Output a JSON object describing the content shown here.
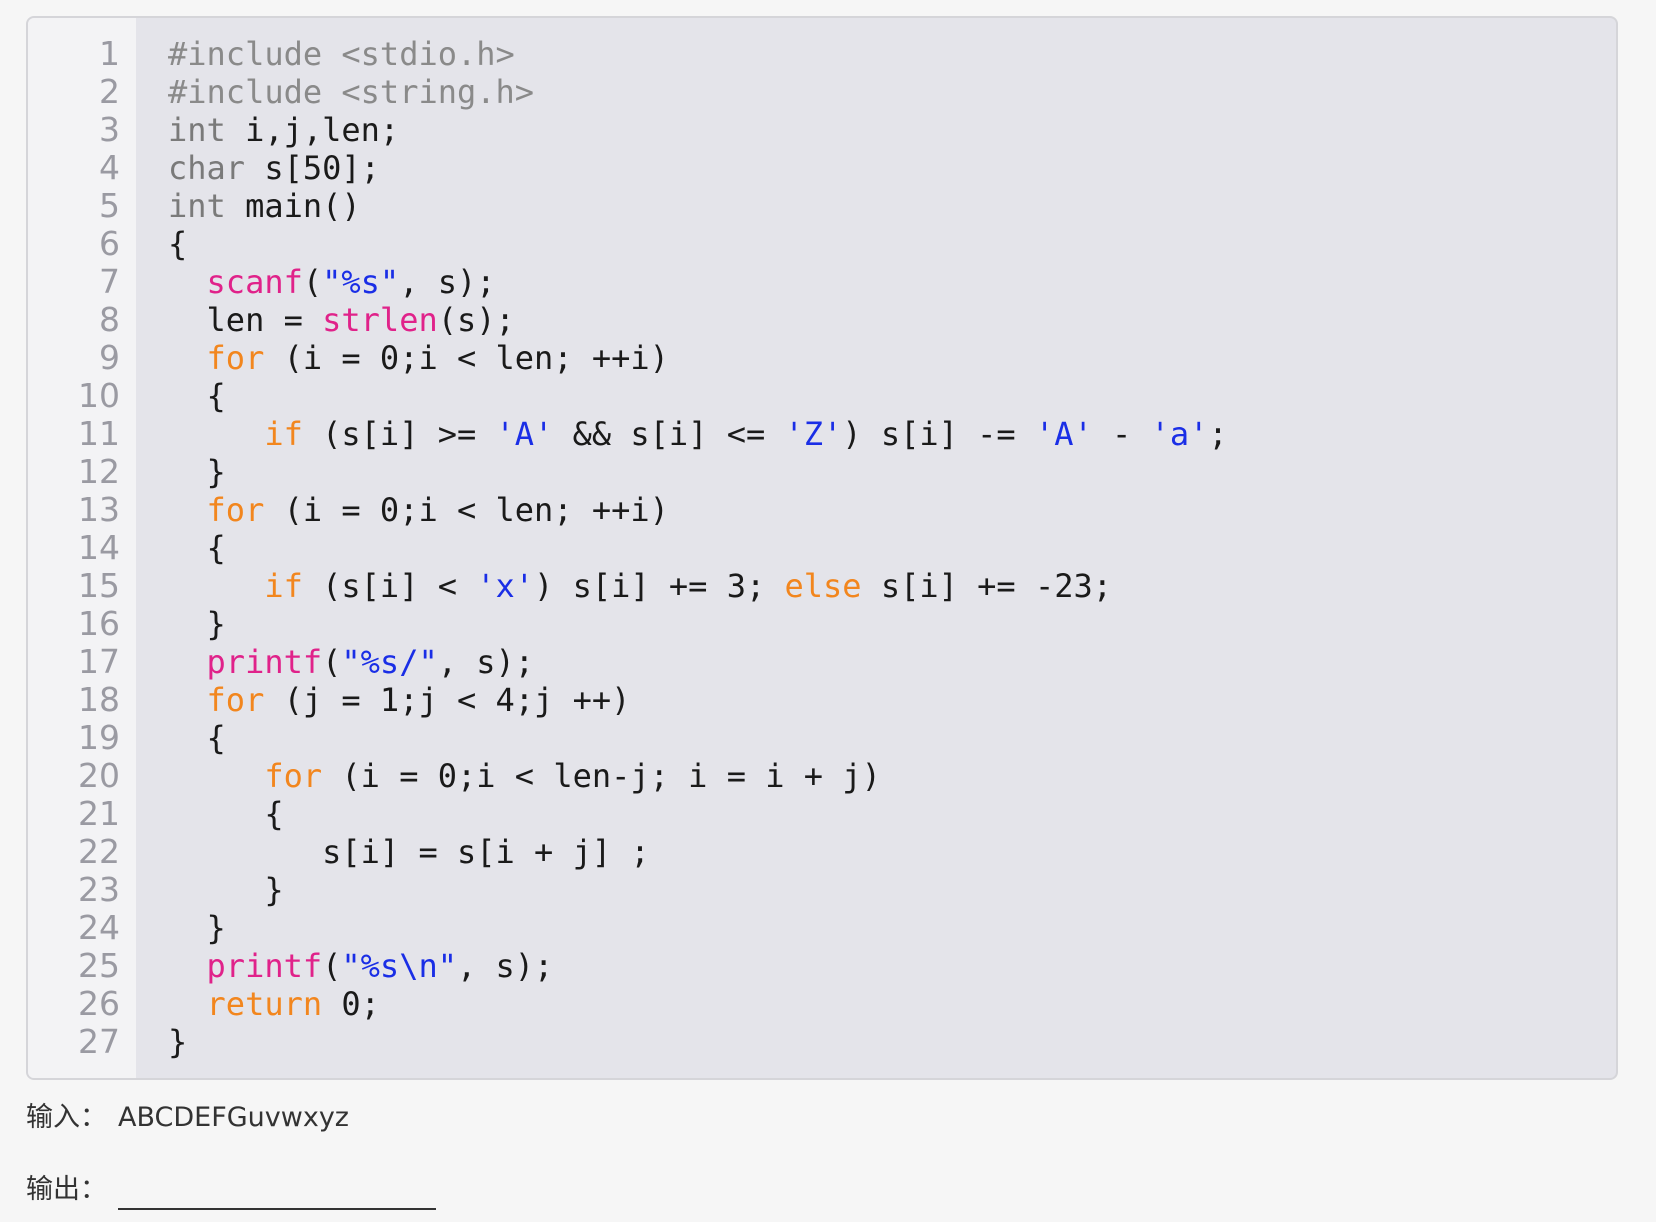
{
  "colors": {
    "preprocessor": "#8a8a8a",
    "type": "#7a7a7a",
    "keyword": "#f2861e",
    "function": "#e0228a",
    "string": "#1a2ee6",
    "plain": "#1a1a1a"
  },
  "code": {
    "lines": [
      {
        "num": "1",
        "tokens": [
          {
            "t": "pre",
            "v": "#include <stdio.h>"
          }
        ]
      },
      {
        "num": "2",
        "tokens": [
          {
            "t": "pre",
            "v": "#include <string.h>"
          }
        ]
      },
      {
        "num": "3",
        "tokens": [
          {
            "t": "type",
            "v": "int"
          },
          {
            "t": "plain",
            "v": " i,j,len;"
          }
        ]
      },
      {
        "num": "4",
        "tokens": [
          {
            "t": "type",
            "v": "char"
          },
          {
            "t": "plain",
            "v": " s[50];"
          }
        ]
      },
      {
        "num": "5",
        "tokens": [
          {
            "t": "type",
            "v": "int"
          },
          {
            "t": "plain",
            "v": " main()"
          }
        ]
      },
      {
        "num": "6",
        "tokens": [
          {
            "t": "plain",
            "v": "{"
          }
        ]
      },
      {
        "num": "7",
        "tokens": [
          {
            "t": "plain",
            "v": "  "
          },
          {
            "t": "fn",
            "v": "scanf"
          },
          {
            "t": "plain",
            "v": "("
          },
          {
            "t": "str",
            "v": "\"%s\""
          },
          {
            "t": "plain",
            "v": ", s);"
          }
        ]
      },
      {
        "num": "8",
        "tokens": [
          {
            "t": "plain",
            "v": "  len = "
          },
          {
            "t": "fn",
            "v": "strlen"
          },
          {
            "t": "plain",
            "v": "(s);"
          }
        ]
      },
      {
        "num": "9",
        "tokens": [
          {
            "t": "plain",
            "v": "  "
          },
          {
            "t": "kw",
            "v": "for"
          },
          {
            "t": "plain",
            "v": " (i = 0;i < len; ++i)"
          }
        ]
      },
      {
        "num": "10",
        "tokens": [
          {
            "t": "plain",
            "v": "  {"
          }
        ]
      },
      {
        "num": "11",
        "tokens": [
          {
            "t": "plain",
            "v": "     "
          },
          {
            "t": "kw",
            "v": "if"
          },
          {
            "t": "plain",
            "v": " (s[i] >= "
          },
          {
            "t": "str",
            "v": "'A'"
          },
          {
            "t": "plain",
            "v": " && s[i] <= "
          },
          {
            "t": "str",
            "v": "'Z'"
          },
          {
            "t": "plain",
            "v": ") s[i] -= "
          },
          {
            "t": "str",
            "v": "'A'"
          },
          {
            "t": "plain",
            "v": " - "
          },
          {
            "t": "str",
            "v": "'a'"
          },
          {
            "t": "plain",
            "v": ";"
          }
        ]
      },
      {
        "num": "12",
        "tokens": [
          {
            "t": "plain",
            "v": "  }"
          }
        ]
      },
      {
        "num": "13",
        "tokens": [
          {
            "t": "plain",
            "v": "  "
          },
          {
            "t": "kw",
            "v": "for"
          },
          {
            "t": "plain",
            "v": " (i = 0;i < len; ++i)"
          }
        ]
      },
      {
        "num": "14",
        "tokens": [
          {
            "t": "plain",
            "v": "  {"
          }
        ]
      },
      {
        "num": "15",
        "tokens": [
          {
            "t": "plain",
            "v": "     "
          },
          {
            "t": "kw",
            "v": "if"
          },
          {
            "t": "plain",
            "v": " (s[i] < "
          },
          {
            "t": "str",
            "v": "'x'"
          },
          {
            "t": "plain",
            "v": ") s[i] += 3; "
          },
          {
            "t": "kw",
            "v": "else"
          },
          {
            "t": "plain",
            "v": " s[i] += -23;"
          }
        ]
      },
      {
        "num": "16",
        "tokens": [
          {
            "t": "plain",
            "v": "  }"
          }
        ]
      },
      {
        "num": "17",
        "tokens": [
          {
            "t": "plain",
            "v": "  "
          },
          {
            "t": "fn",
            "v": "printf"
          },
          {
            "t": "plain",
            "v": "("
          },
          {
            "t": "str",
            "v": "\"%s/\""
          },
          {
            "t": "plain",
            "v": ", s);"
          }
        ]
      },
      {
        "num": "18",
        "tokens": [
          {
            "t": "plain",
            "v": "  "
          },
          {
            "t": "kw",
            "v": "for"
          },
          {
            "t": "plain",
            "v": " (j = 1;j < 4;j ++)"
          }
        ]
      },
      {
        "num": "19",
        "tokens": [
          {
            "t": "plain",
            "v": "  {"
          }
        ]
      },
      {
        "num": "20",
        "tokens": [
          {
            "t": "plain",
            "v": "     "
          },
          {
            "t": "kw",
            "v": "for"
          },
          {
            "t": "plain",
            "v": " (i = 0;i < len-j; i = i + j)"
          }
        ]
      },
      {
        "num": "21",
        "tokens": [
          {
            "t": "plain",
            "v": "     {"
          }
        ]
      },
      {
        "num": "22",
        "tokens": [
          {
            "t": "plain",
            "v": "        s[i] = s[i + j] ;"
          }
        ]
      },
      {
        "num": "23",
        "tokens": [
          {
            "t": "plain",
            "v": "     }"
          }
        ]
      },
      {
        "num": "24",
        "tokens": [
          {
            "t": "plain",
            "v": "  }"
          }
        ]
      },
      {
        "num": "25",
        "tokens": [
          {
            "t": "plain",
            "v": "  "
          },
          {
            "t": "fn",
            "v": "printf"
          },
          {
            "t": "plain",
            "v": "("
          },
          {
            "t": "str",
            "v": "\"%s\\n\""
          },
          {
            "t": "plain",
            "v": ", s);"
          }
        ]
      },
      {
        "num": "26",
        "tokens": [
          {
            "t": "plain",
            "v": "  "
          },
          {
            "t": "kw",
            "v": "return"
          },
          {
            "t": "plain",
            "v": " 0;"
          }
        ]
      },
      {
        "num": "27",
        "tokens": [
          {
            "t": "plain",
            "v": "}"
          }
        ]
      }
    ]
  },
  "io": {
    "input_label": "输入：",
    "input_value": "ABCDEFGuvwxyz",
    "output_label": "输出："
  }
}
